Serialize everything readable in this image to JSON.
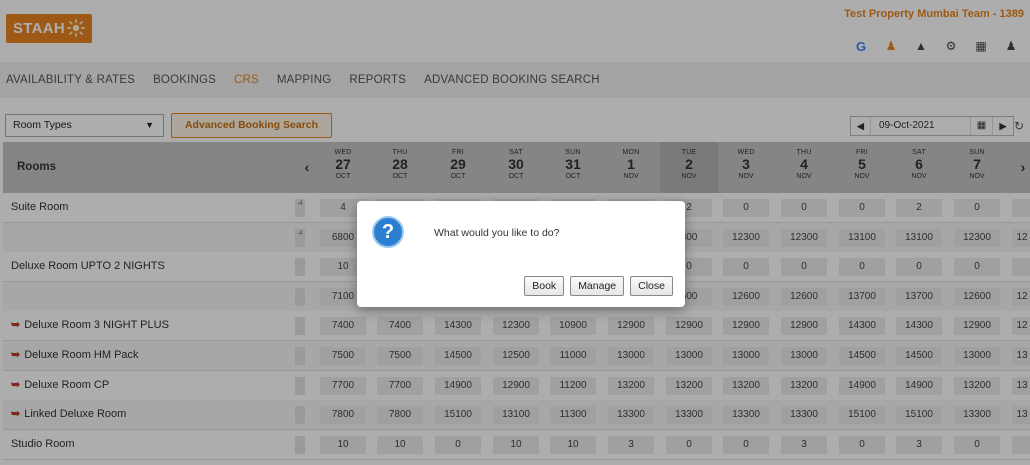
{
  "header": {
    "logo_text": "STAAH",
    "property_name": "Test Property Mumbai Team - 1389",
    "icons": [
      "google-icon",
      "notification-icon",
      "warning-icon",
      "settings-icon",
      "apps-icon",
      "user-icon"
    ]
  },
  "nav": {
    "items": [
      "AVAILABILITY & RATES",
      "BOOKINGS",
      "CRS",
      "MAPPING",
      "REPORTS",
      "ADVANCED BOOKING SEARCH"
    ],
    "active": "CRS"
  },
  "toolbar": {
    "room_type_select": "Room Types",
    "advanced_search_button": "Advanced Booking Search",
    "date_value": "09-Oct-2021"
  },
  "grid": {
    "rooms_header": "Rooms",
    "dates": [
      {
        "weekday": "WED",
        "day": "27",
        "month": "OCT"
      },
      {
        "weekday": "THU",
        "day": "28",
        "month": "OCT"
      },
      {
        "weekday": "FRI",
        "day": "29",
        "month": "OCT"
      },
      {
        "weekday": "SAT",
        "day": "30",
        "month": "OCT"
      },
      {
        "weekday": "SUN",
        "day": "31",
        "month": "OCT"
      },
      {
        "weekday": "MON",
        "day": "1",
        "month": "NOV"
      },
      {
        "weekday": "TUE",
        "day": "2",
        "month": "NOV"
      },
      {
        "weekday": "WED",
        "day": "3",
        "month": "NOV"
      },
      {
        "weekday": "THU",
        "day": "4",
        "month": "NOV"
      },
      {
        "weekday": "FRI",
        "day": "5",
        "month": "NOV"
      },
      {
        "weekday": "SAT",
        "day": "6",
        "month": "NOV"
      },
      {
        "weekday": "SUN",
        "day": "7",
        "month": "NOV"
      }
    ],
    "rows": [
      {
        "name": "Suite Room",
        "linked": false,
        "mini": "-4",
        "values": [
          "4",
          "",
          "",
          "",
          "",
          "",
          "2",
          "0",
          "0",
          "0",
          "2",
          "0",
          ""
        ]
      },
      {
        "name": "",
        "linked": false,
        "mini": "-4",
        "values": [
          "6800",
          "",
          "",
          "",
          "",
          "",
          "300",
          "12300",
          "12300",
          "13100",
          "13100",
          "12300",
          "12"
        ]
      },
      {
        "name": "Deluxe Room UPTO 2 NIGHTS",
        "linked": false,
        "mini": "",
        "values": [
          "10",
          "",
          "",
          "",
          "",
          "",
          "0",
          "0",
          "0",
          "0",
          "0",
          "0",
          ""
        ]
      },
      {
        "name": "",
        "linked": false,
        "mini": "",
        "values": [
          "7100",
          "",
          "",
          "",
          "",
          "",
          "600",
          "12600",
          "12600",
          "13700",
          "13700",
          "12600",
          "12"
        ]
      },
      {
        "name": "Deluxe Room 3 NIGHT PLUS",
        "linked": true,
        "mini": "",
        "values": [
          "7400",
          "7400",
          "14300",
          "12300",
          "10900",
          "12900",
          "12900",
          "12900",
          "12900",
          "14300",
          "14300",
          "12900",
          "12"
        ]
      },
      {
        "name": "Deluxe Room HM Pack",
        "linked": true,
        "mini": "",
        "values": [
          "7500",
          "7500",
          "14500",
          "12500",
          "11000",
          "13000",
          "13000",
          "13000",
          "13000",
          "14500",
          "14500",
          "13000",
          "13"
        ]
      },
      {
        "name": "Deluxe Room CP",
        "linked": true,
        "mini": "",
        "values": [
          "7700",
          "7700",
          "14900",
          "12900",
          "11200",
          "13200",
          "13200",
          "13200",
          "13200",
          "14900",
          "14900",
          "13200",
          "13"
        ]
      },
      {
        "name": "Linked Deluxe Room",
        "linked": true,
        "mini": "",
        "values": [
          "7800",
          "7800",
          "15100",
          "13100",
          "11300",
          "13300",
          "13300",
          "13300",
          "13300",
          "15100",
          "15100",
          "13300",
          "13"
        ]
      },
      {
        "name": "Studio Room",
        "linked": false,
        "mini": "",
        "values": [
          "10",
          "10",
          "0",
          "10",
          "10",
          "3",
          "0",
          "0",
          "3",
          "0",
          "3",
          "0",
          ""
        ]
      }
    ]
  },
  "dialog": {
    "message": "What would you like to do?",
    "buttons": [
      "Book",
      "Manage",
      "Close"
    ]
  }
}
